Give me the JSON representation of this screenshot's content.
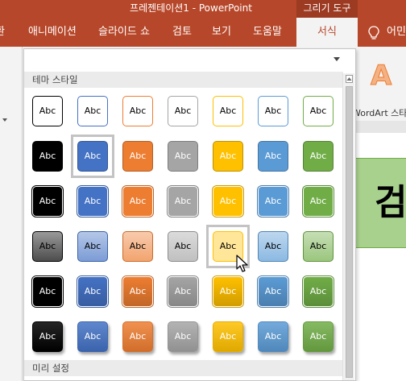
{
  "titlebar": {
    "title": "프레젠테이션1  -  PowerPoint",
    "context_group": "그리기 도구"
  },
  "tabs": [
    {
      "label": "환"
    },
    {
      "label": "애니메이션"
    },
    {
      "label": "슬라이드 쇼"
    },
    {
      "label": "검토"
    },
    {
      "label": "보기"
    },
    {
      "label": "도움말"
    },
    {
      "label": "서식"
    },
    {
      "label": "어민"
    }
  ],
  "gallery": {
    "theme_section": "테마 스타일",
    "preset_section": "미리 설정",
    "tile_label": "Abc",
    "selected_tile": {
      "row": 1,
      "col": 1
    },
    "hovered_tile": {
      "row": 3,
      "col": 4
    }
  },
  "wordart": {
    "glyph": "A",
    "label": "WordArt 스타"
  },
  "slide": {
    "text": "검"
  },
  "colors": {
    "brand": "#b7472a",
    "palette": [
      "#000000",
      "#4472c4",
      "#ed7d31",
      "#a5a5a5",
      "#ffc000",
      "#5b9bd5",
      "#70ad47"
    ]
  }
}
